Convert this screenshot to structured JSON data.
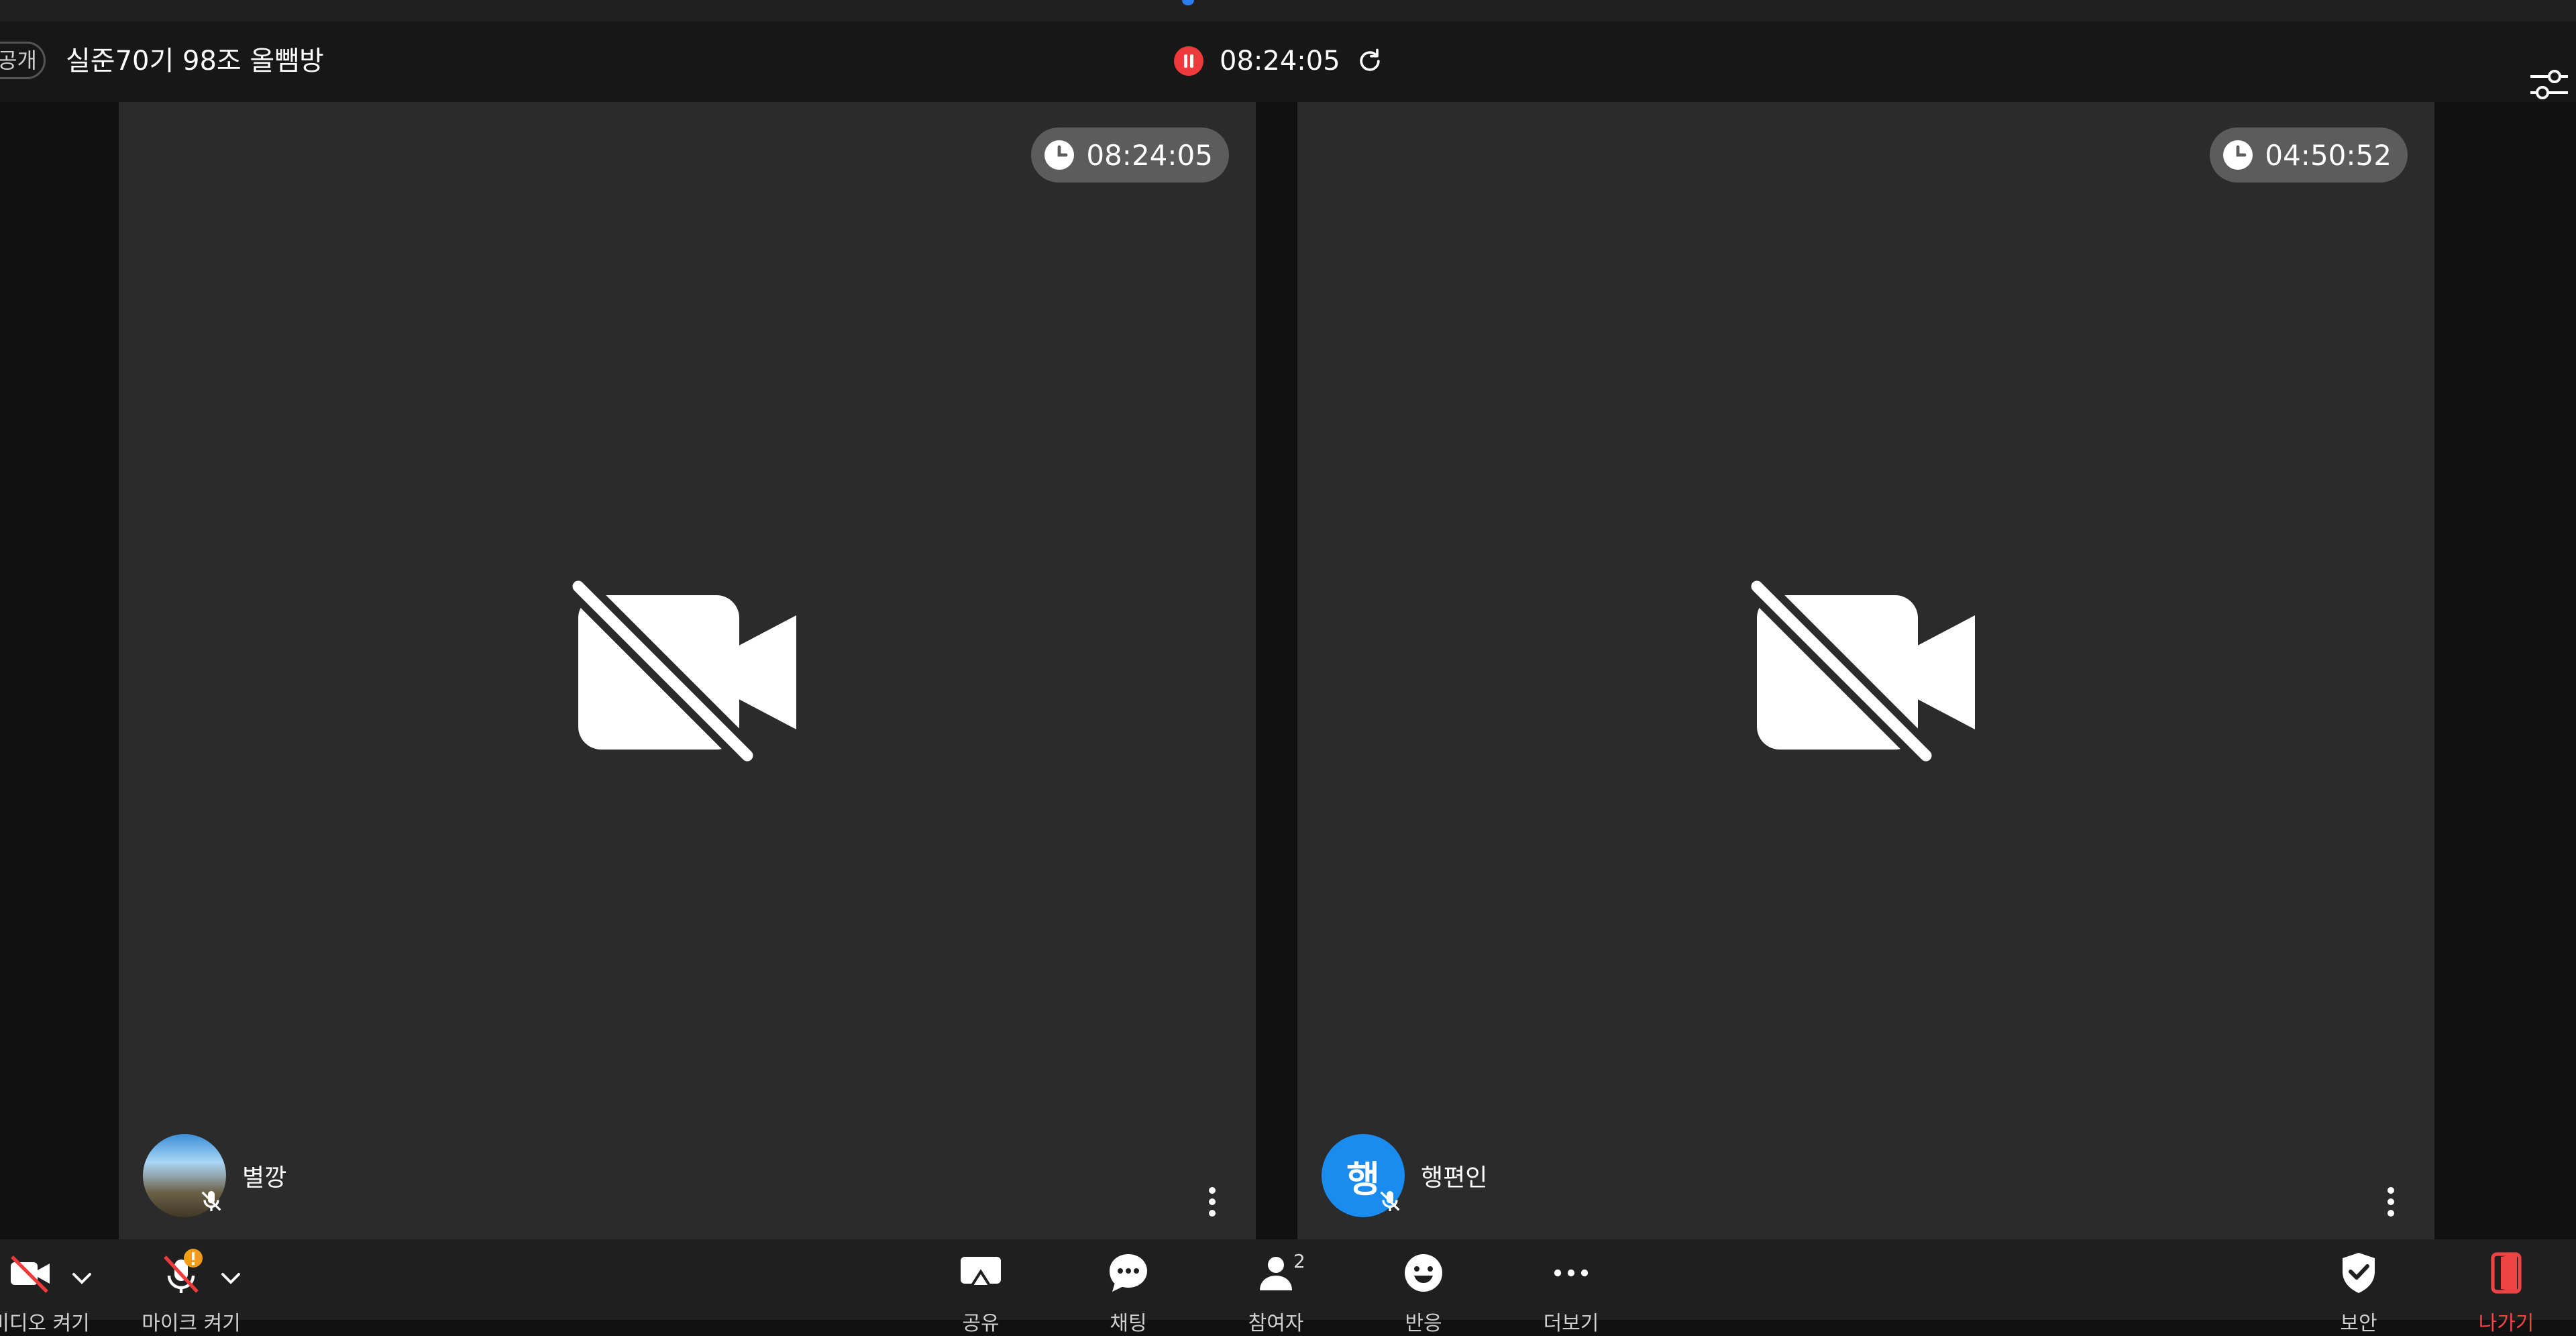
{
  "header": {
    "visibility_badge": "공개",
    "room_title": "실준70기 98조 올뺌방",
    "elapsed_time": "08:24:05"
  },
  "tiles": [
    {
      "timer": "08:24:05",
      "name": "별깡",
      "avatar": "photo",
      "mic": "muted",
      "camera": "off"
    },
    {
      "timer": "04:50:52",
      "name": "행편인",
      "avatar_initial": "행",
      "avatar_color": "#1a8cf0",
      "mic": "muted",
      "camera": "off"
    }
  ],
  "controls": {
    "camera_label": "비디오 켜기",
    "mic_label": "마이크 켜기",
    "share_label": "공유",
    "chat_label": "채팅",
    "participants_label": "참여자",
    "participants_count": "2",
    "reactions_label": "반응",
    "more_label": "더보기",
    "security_label": "보안",
    "leave_label": "나가기"
  },
  "colors": {
    "background": "#111111",
    "tile": "#2b2b2b",
    "record": "#ee3a3a",
    "mic_warning": "#f29d1a",
    "leave": "#ee4444",
    "avatar_blue": "#1a8cf0"
  }
}
